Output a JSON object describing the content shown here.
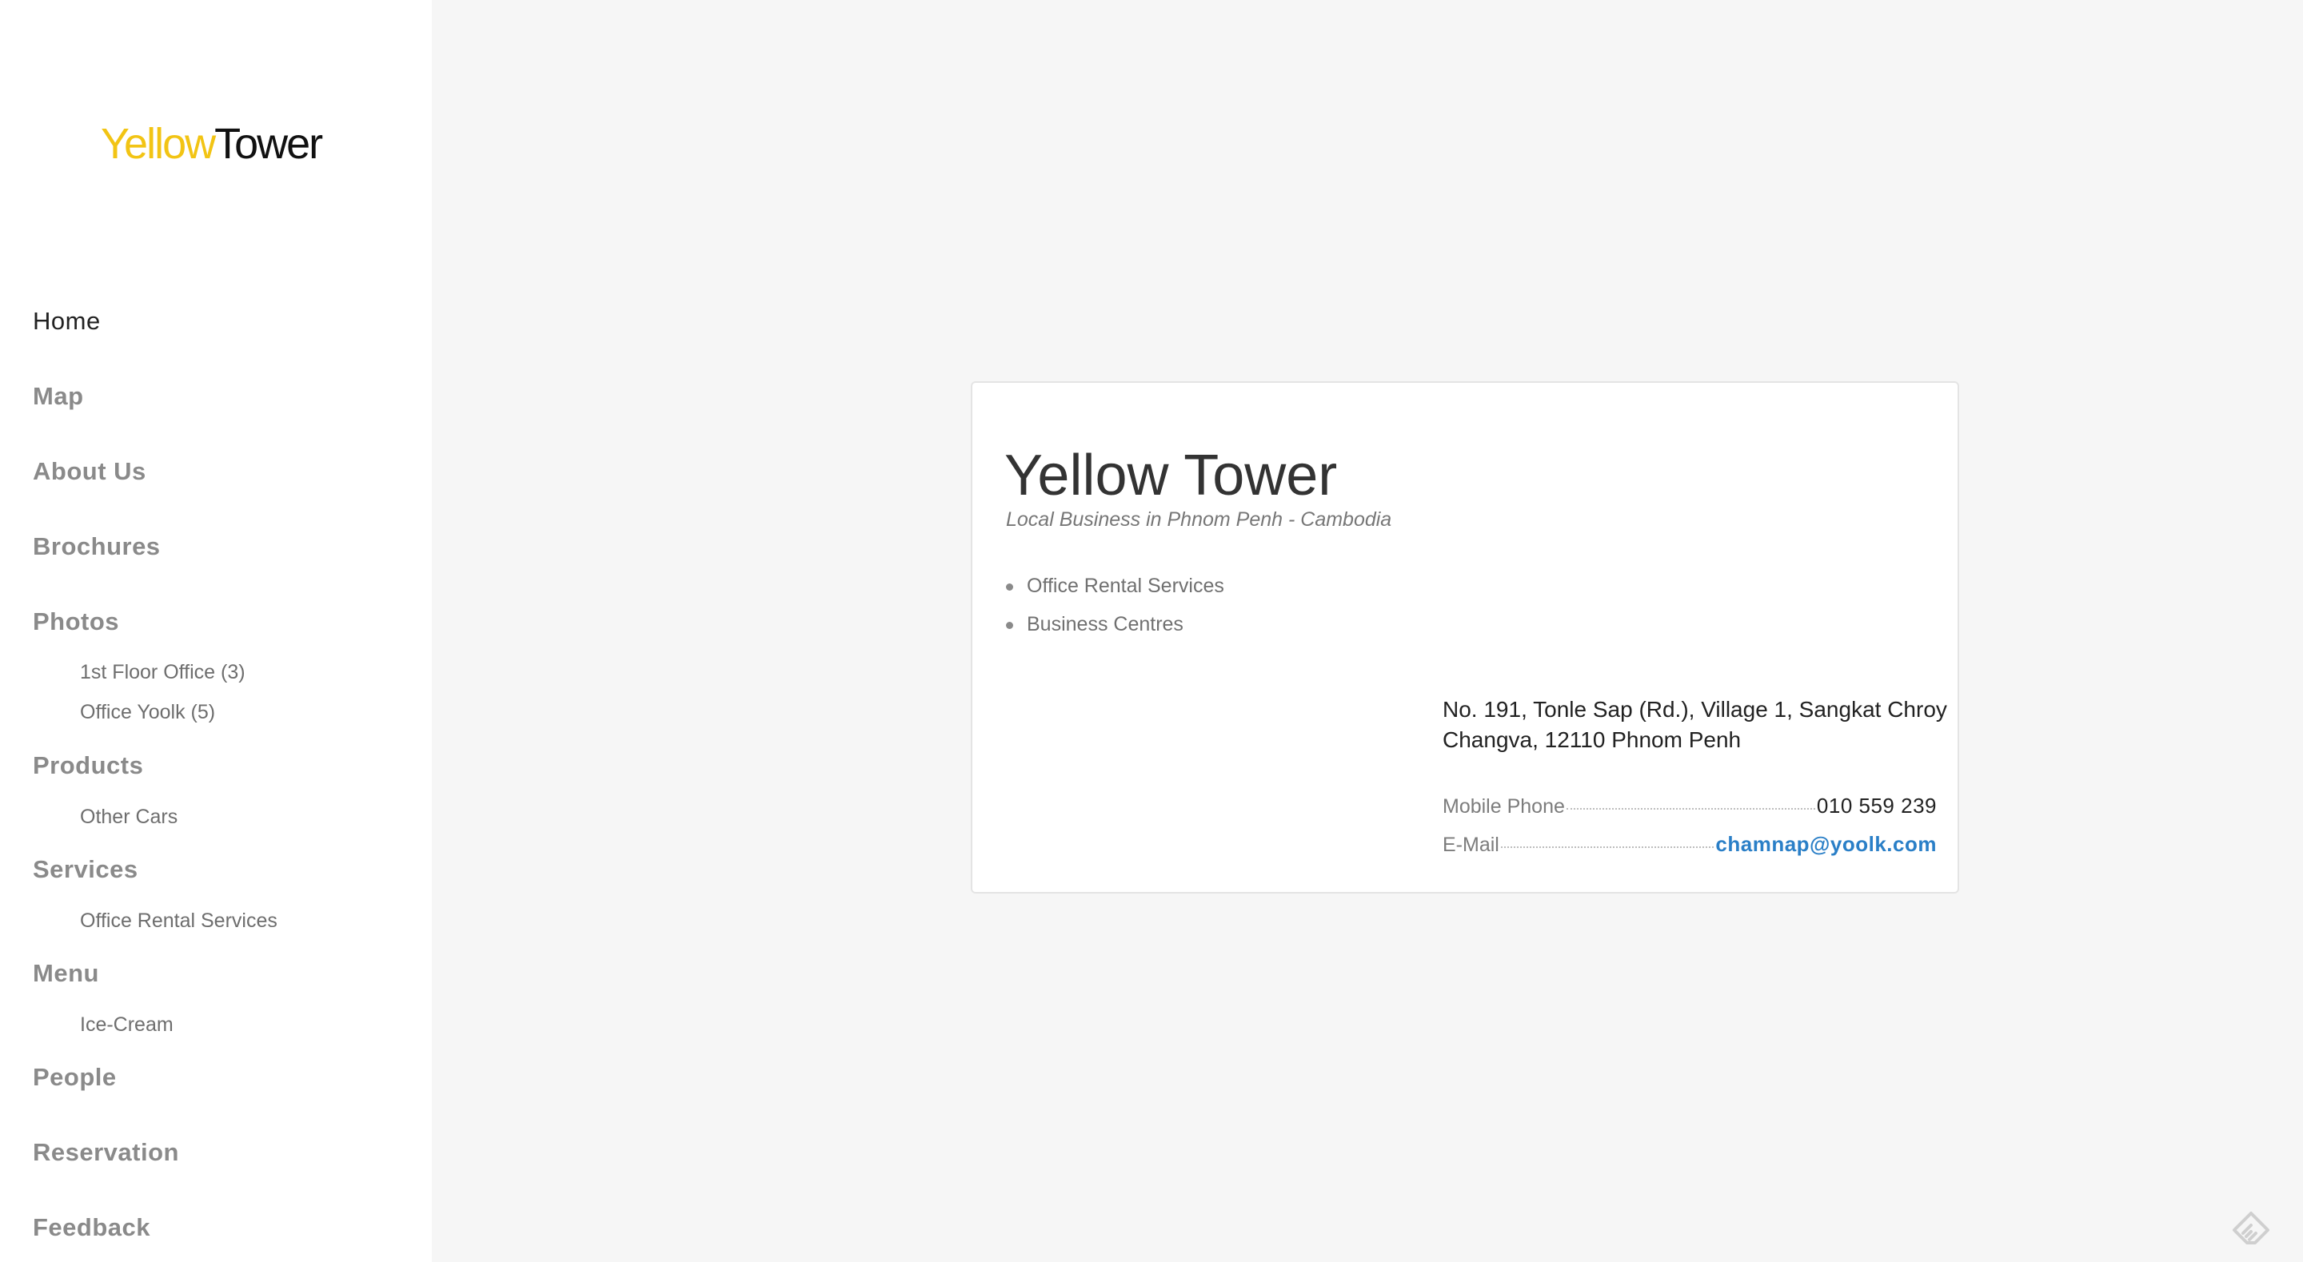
{
  "brand": {
    "logo_yellow": "Yellow",
    "logo_dark": "Tower",
    "yellow_color": "#f2c414"
  },
  "sidebar": {
    "items": [
      {
        "label": "Home",
        "active": true
      },
      {
        "label": "Map"
      },
      {
        "label": "About Us"
      },
      {
        "label": "Brochures"
      },
      {
        "label": "Photos",
        "children": [
          "1st Floor Office (3)",
          "Office Yoolk (5)"
        ]
      },
      {
        "label": "Products",
        "children": [
          "Other Cars"
        ]
      },
      {
        "label": "Services",
        "children": [
          "Office Rental Services"
        ]
      },
      {
        "label": "Menu",
        "children": [
          "Ice-Cream"
        ]
      },
      {
        "label": "People"
      },
      {
        "label": "Reservation"
      },
      {
        "label": "Feedback"
      }
    ]
  },
  "listing": {
    "title": "Yellow Tower",
    "subtitle": "Local Business in Phnom Penh - Cambodia",
    "categories": [
      "Office Rental Services",
      "Business Centres"
    ],
    "address_line1": "No. 191, Tonle Sap (Rd.), Village 1, Sangkat Chroy",
    "address_line2": "Changva, 12110 Phnom Penh",
    "contacts": [
      {
        "label": "Mobile Phone",
        "value": "010 559 239"
      },
      {
        "label": "E-Mail",
        "value": "chamnap@yoolk.com"
      }
    ]
  },
  "icons": {
    "corner": "feedly-icon"
  }
}
